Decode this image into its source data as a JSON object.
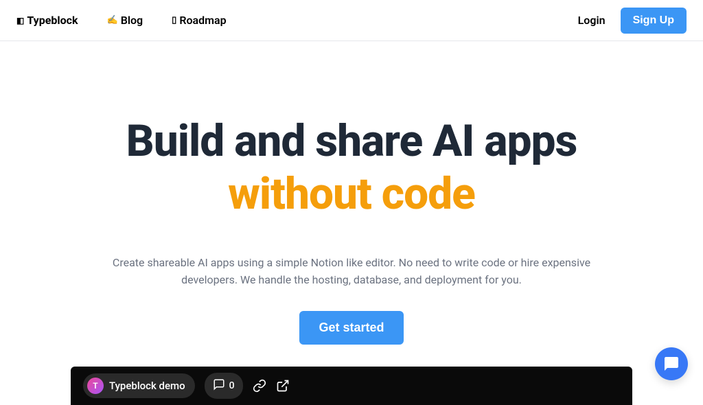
{
  "nav": {
    "logo_icon": "◧",
    "logo_text": "Typeblock",
    "blog_icon": "✍",
    "blog_label": "Blog",
    "roadmap_icon": "▯",
    "roadmap_label": "Roadmap",
    "login_label": "Login",
    "signup_label": "Sign Up"
  },
  "hero": {
    "title_line1": "Build and share AI apps",
    "title_line2": "without code",
    "subtitle": "Create shareable AI apps using a simple Notion like editor. No need to write code or hire expensive developers. We handle the hosting, database, and deployment for you.",
    "cta_label": "Get started"
  },
  "video": {
    "avatar_letter": "T",
    "title": "Typeblock demo",
    "comments_count": "0"
  }
}
